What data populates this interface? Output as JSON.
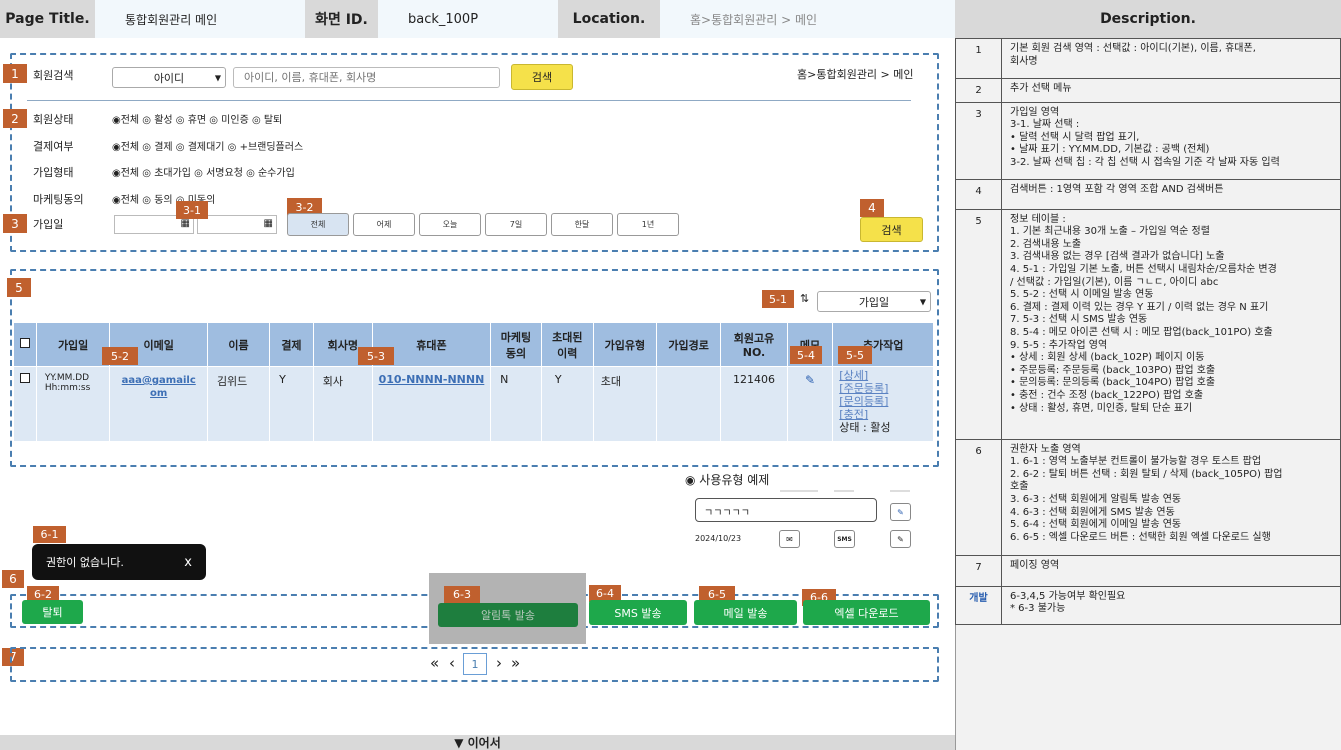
{
  "header": {
    "page_title_label": "Page Title.",
    "page_title": "통합회원관리 메인",
    "screen_id_label": "화면 ID.",
    "screen_id": "back_100P",
    "location_label": "Location.",
    "location": "홈>통합회원관리 > 메인",
    "description_label": "Description."
  },
  "search": {
    "label": "회원검색",
    "select_value": "아이디",
    "placeholder": "아이디, 이름, 휴대폰, 회사명",
    "button": "검색",
    "breadcrumb": "홈>통합회원관리 > 메인"
  },
  "filters": [
    {
      "label": "회원상태",
      "options": "◉전체 ◎ 활성 ◎ 휴면 ◎ 미인증 ◎ 탈퇴"
    },
    {
      "label": "결제여부",
      "options": "◉전체 ◎ 결제 ◎ 결제대기 ◎ +브랜딩플러스"
    },
    {
      "label": "가입형태",
      "options": "◉전체 ◎ 초대가입 ◎ 서명요청 ◎ 순수가입"
    },
    {
      "label": "마케팅동의",
      "options": "◉전체 ◎ 동의 ◎ 미동의"
    }
  ],
  "join_date": {
    "label": "가입일",
    "ranges": [
      "전체",
      "어제",
      "오늘",
      "7일",
      "한달",
      "1년"
    ],
    "search_button": "검색"
  },
  "sort": {
    "value": "가입일",
    "icon": "sort-arrows-icon"
  },
  "table": {
    "headers": [
      "가입일",
      "이메일",
      "이름",
      "결제",
      "회사명",
      "휴대폰",
      "마케팅\n동의",
      "초대된\n이력",
      "가입유형",
      "가입경로",
      "회원고유\nNO.",
      "메모",
      "추가작업"
    ],
    "row": {
      "date": "YY.MM.DD\nHh:mm:ss",
      "email": "aaa@gamailc\nom",
      "name": "김위드",
      "paid": "Y",
      "company": "회사",
      "phone": "010-NNNN-NNNN",
      "marketing": "N",
      "invited": "Y",
      "join_type": "초대",
      "join_path": "",
      "member_no": "121406",
      "actions": [
        "[상세]",
        "[주문등록]",
        "[문의등록]",
        "[충전]"
      ],
      "status": "상태 : 활성"
    }
  },
  "markers": {
    "m1": "1",
    "m2": "2",
    "m3": "3",
    "m31": "3-1",
    "m32": "3-2",
    "m4": "4",
    "m5": "5",
    "m51": "5-1",
    "m52": "5-2",
    "m53": "5-3",
    "m54": "5-4",
    "m55": "5-5",
    "m6": "6",
    "m61": "6-1",
    "m62": "6-2",
    "m63": "6-3",
    "m64": "6-4",
    "m65": "6-5",
    "m66": "6-6",
    "m7": "7"
  },
  "usage": {
    "title": "◉ 사용유형 예제",
    "input_value": "ㄱㄱㄱㄱㄱ",
    "date": "2024/10/23",
    "sms": "SMS"
  },
  "toast": {
    "text": "권한이 없습니다.",
    "close": "x"
  },
  "actions": {
    "withdraw": "탈퇴",
    "alimtalk": "알림톡 발송",
    "sms": "SMS 발송",
    "mail": "메일 발송",
    "excel": "엑셀 다운로드"
  },
  "paging": {
    "first": "«",
    "prev": "‹",
    "current": "1",
    "next": "›",
    "last": "»"
  },
  "continue": "▼ 이어서",
  "descriptions": [
    {
      "n": "1",
      "text": "기본 회원 검색 영역 : 선택값 : 아이디(기본), 이름, 휴대폰,\n회사명"
    },
    {
      "n": "2",
      "text": "추가 선택 메뉴"
    },
    {
      "n": "3",
      "text": "가입일 영역\n3-1. 날짜 선택 :\n•      달력 선택 시 달력 팝업 표기,\n•      날짜 표기 : YY.MM.DD, 기본값 : 공백 (전체)\n3-2. 날짜 선택 칩 : 각 칩 선택 시 접속일 기준 각 날짜 자동 입력"
    },
    {
      "n": "4",
      "text": "검색버튼 : 1영역 포함 각 영역 조합 AND 검색버튼"
    },
    {
      "n": "5",
      "text": "정보 테이블 :\n1.     기본 최근내용 30개 노출 – 가입일 역순 정렬\n2.     검색내용 노출\n3.     검색내용 없는 경우 [검색 결과가 없습니다] 노출\n4.     5-1 : 가입일 기본 노출, 버튼 선택시 내림차순/오름차순 변경\n        / 선택값 : 가입일(기본), 이름 ㄱㄴㄷ, 아이디 abc\n5.     5-2 : 선택 시 이메일 발송 연동\n6.     결제 : 결제 이력 있는 경우 Y 표기 / 이력 없는 경우 N 표기\n7.     5-3 : 선택 시 SMS 발송 연동\n8.     5-4 : 메모 아이콘 선택 시 : 메모 팝업(back_101PO) 호출\n9.     5-5 : 추가작업 영역\n•      상세 : 회원 상세 (back_102P) 페이지 이동\n•      주문등록: 주문등록 (back_103PO) 팝업 호출\n•      문의등록: 문의등록 (back_104PO) 팝업 호출\n•      충전 : 건수 조정 (back_122PO) 팝업 호출\n•      상태 : 활성, 휴면, 미인증, 탈퇴 단순 표기"
    },
    {
      "n": "6",
      "text": "권한자 노출 영역\n1.     6-1 : 영역 노출부분 컨트롤이 불가능할 경우 토스트 팝업\n2.     6-2 : 탈퇴 버튼 선택 : 회원 탈퇴 / 삭제 (back_105PO) 팝업\n        호출\n3.     6-3 : 선택 회원에게  알림톡 발송 연동\n4.     6-3 : 선택 회원에게 SMS 발송 연동\n5.     6-4 : 선택 회원에게 이메일 발송 연동\n6.     6-5 : 엑셀 다운로드 버튼 : 선택한 회원 엑셀 다운로드 실행"
    },
    {
      "n": "7",
      "text": "페이징 영역"
    },
    {
      "n": "개발",
      "text": "6-3,4,5 가능여부 확인필요\n* 6-3 불가능"
    }
  ]
}
